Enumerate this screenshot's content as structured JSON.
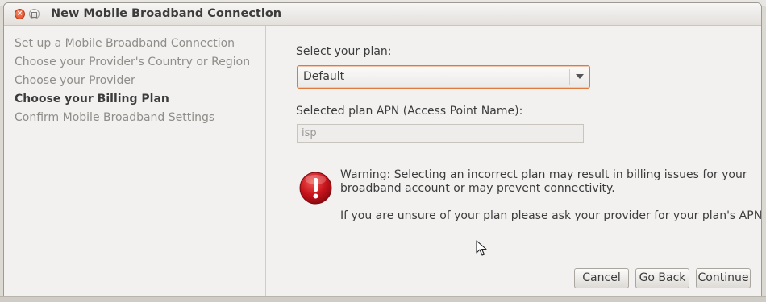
{
  "window": {
    "title": "New Mobile Broadband Connection",
    "close_glyph": "×"
  },
  "sidebar": {
    "steps": [
      {
        "label": "Set up a Mobile Broadband Connection",
        "active": false
      },
      {
        "label": "Choose your Provider's Country or Region",
        "active": false
      },
      {
        "label": "Choose your Provider",
        "active": false
      },
      {
        "label": "Choose your Billing Plan",
        "active": true
      },
      {
        "label": "Confirm Mobile Broadband Settings",
        "active": false
      }
    ]
  },
  "plan": {
    "label": "Select your plan:",
    "selected": "Default"
  },
  "apn": {
    "label": "Selected plan APN (Access Point Name):",
    "value": "isp"
  },
  "warning": {
    "icon": "warning-icon",
    "text": "Warning: Selecting an incorrect plan may result in billing issues for your broadband account or may prevent connectivity.",
    "hint": "If you are unsure of your plan please ask your provider for your plan's APN."
  },
  "buttons": {
    "cancel": "Cancel",
    "back": "Go Back",
    "continue": "Continue"
  },
  "colors": {
    "accent_focus": "#e0793f",
    "warning_red": "#c8141c",
    "active_text": "#3c3c3c",
    "inactive_text": "#8f8d89"
  }
}
